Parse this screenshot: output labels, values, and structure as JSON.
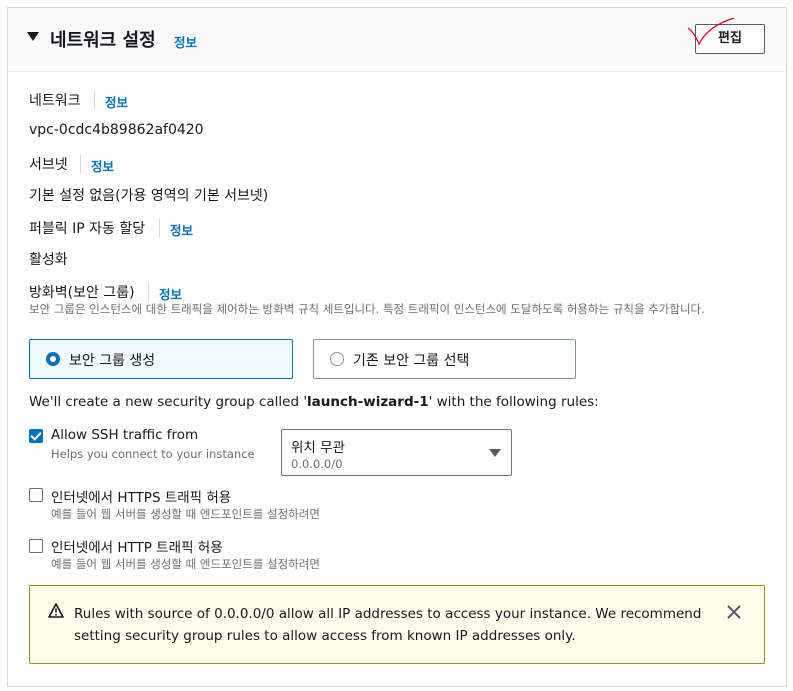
{
  "header": {
    "title": "네트워크 설정",
    "info": "정보",
    "edit_label": "편집"
  },
  "network": {
    "label": "네트워크",
    "info": "정보",
    "value": "vpc-0cdc4b89862af0420"
  },
  "subnet": {
    "label": "서브넷",
    "info": "정보",
    "value": "기본 설정 없음(가용 영역의 기본 서브넷)"
  },
  "public_ip": {
    "label": "퍼블릭 IP 자동 할당",
    "info": "정보",
    "value": "활성화"
  },
  "firewall": {
    "label": "방화벽(보안 그룹)",
    "info": "정보",
    "description": "보안 그룹은 인스턴스에 대한 트래픽을 제어하는 방화벽 규칙 세트입니다. 특정 트래픽이 인스턴스에 도달하도록 허용하는 규칙을 추가합니다.",
    "options": [
      {
        "label": "보안 그룹 생성",
        "selected": true
      },
      {
        "label": "기존 보안 그룹 선택",
        "selected": false
      }
    ]
  },
  "create_msg": {
    "prefix": "We'll create a new security group called '",
    "name": "launch-wizard-1",
    "suffix": "' with the following rules:"
  },
  "rules": [
    {
      "label": "Allow SSH traffic from",
      "sub": "Helps you connect to your instance",
      "checked": true
    },
    {
      "label": "인터넷에서 HTTPS 트래픽 허용",
      "sub": "예를 들어 웹 서버를 생성할 때 엔드포인트를 설정하려면",
      "checked": false
    },
    {
      "label": "인터넷에서 HTTP 트래픽 허용",
      "sub": "예를 들어 웹 서버를 생성할 때 엔드포인트를 설정하려면",
      "checked": false
    }
  ],
  "ssh_source": {
    "value": "위치 무관",
    "sub": "0.0.0.0/0"
  },
  "alert": {
    "text": "Rules with source of 0.0.0.0/0 allow all IP addresses to access your instance. We recommend setting security group rules to allow access from known IP addresses only."
  },
  "colors": {
    "link": "#0073bb",
    "checkbox": "#0073bb",
    "warning_bg": "#fffce9",
    "warning_border": "#ab8b10",
    "annotation": "#d9001b"
  }
}
